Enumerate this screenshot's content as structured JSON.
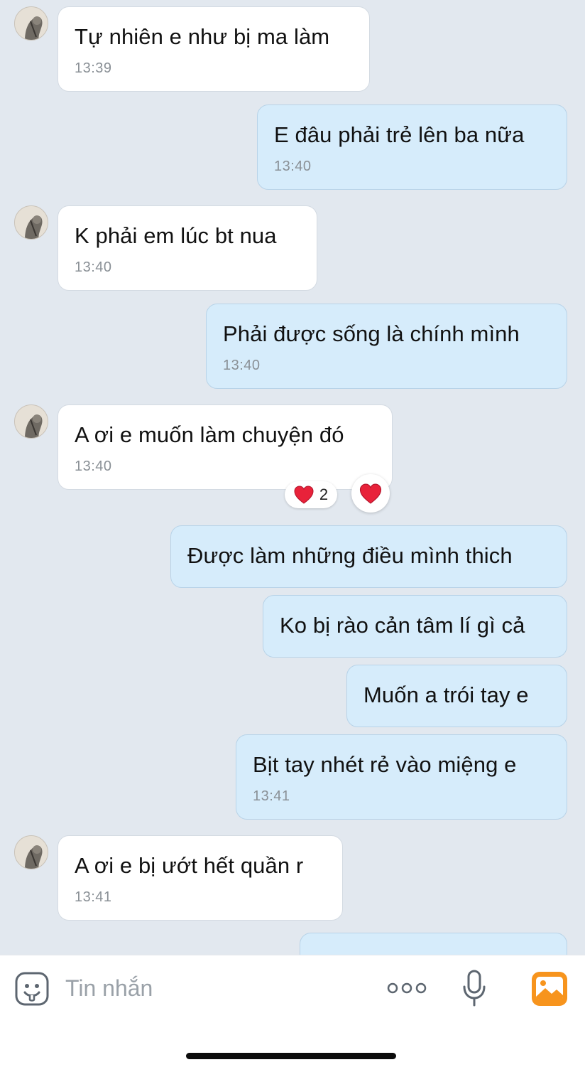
{
  "chat": {
    "messages": [
      {
        "side": "in",
        "text": "Tự nhiên e như bị ma làm",
        "time": "13:39"
      },
      {
        "side": "out",
        "text": "E đâu phải trẻ lên ba nữa",
        "time": "13:40"
      },
      {
        "side": "in",
        "text": "K phải em lúc bt nua",
        "time": "13:40"
      },
      {
        "side": "out",
        "text": "Phải được sống là chính mình",
        "time": "13:40"
      },
      {
        "side": "in",
        "text": "A ơi e muốn làm chuyện đó",
        "time": "13:40"
      },
      {
        "side": "out",
        "text": "Được làm những điều mình thich"
      },
      {
        "side": "out",
        "text": "Ko bị rào cản tâm lí gì cả"
      },
      {
        "side": "out",
        "text": "Muốn a trói tay e"
      },
      {
        "side": "out",
        "text": "Bịt tay nhét rẻ vào miệng e",
        "time": "13:41"
      },
      {
        "side": "in",
        "text": "A ơi e bị ướt hết quần r",
        "time": "13:41"
      }
    ],
    "reaction": {
      "icon": "heart-icon",
      "count": "2",
      "color": "#e8223a"
    }
  },
  "composer": {
    "placeholder": "Tin nhắn",
    "accent_color": "#f7941d"
  }
}
